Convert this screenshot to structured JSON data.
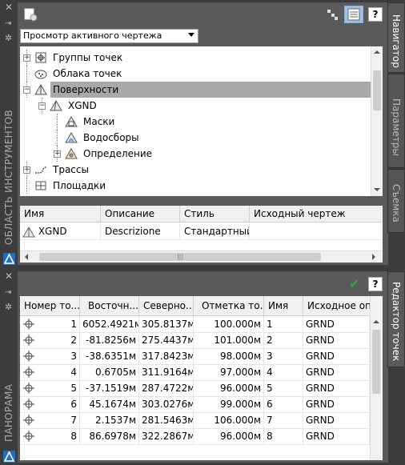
{
  "toolspace": {
    "side_title": "ОБЛАСТЬ ИНСТРУМЕНТОВ",
    "dropdown_value": "Просмотр активного чертежа",
    "tree": [
      {
        "label": "Группы точек",
        "icon": "point-groups-icon",
        "level": 1,
        "expander": "+"
      },
      {
        "label": "Облака точек",
        "icon": "point-clouds-icon",
        "level": 1,
        "expander": ""
      },
      {
        "label": "Поверхности",
        "icon": "surfaces-icon",
        "level": 1,
        "expander": "-",
        "selected": true
      },
      {
        "label": "XGND",
        "icon": "surface-icon",
        "level": 2,
        "expander": "-"
      },
      {
        "label": "Маски",
        "icon": "masks-icon",
        "level": 3,
        "expander": ""
      },
      {
        "label": "Водосборы",
        "icon": "watersheds-icon",
        "level": 3,
        "expander": ""
      },
      {
        "label": "Определение",
        "icon": "definition-icon",
        "level": 3,
        "expander": "+"
      },
      {
        "label": "Трассы",
        "icon": "alignments-icon",
        "level": 1,
        "expander": "+"
      },
      {
        "label": "Площадки",
        "icon": "sites-icon",
        "level": 1,
        "expander": ""
      }
    ],
    "list_headers": [
      "Имя",
      "Описание",
      "Стиль",
      "Исходный чертеж"
    ],
    "list_rows": [
      {
        "name": "XGND",
        "description": "Descrizione",
        "style": "Стандартный",
        "source": ""
      }
    ],
    "tabs": [
      "Навигатор",
      "Параметры",
      "Съемка"
    ]
  },
  "panorama": {
    "side_title": "ПАНОРАМА",
    "tab": "Редактор точек",
    "headers": [
      "Номер то...",
      "Восточн...",
      "Северно...",
      "Отметка то...",
      "Имя",
      "Исходное опи"
    ],
    "rows": [
      {
        "num": "1",
        "east": "6052.4921м",
        "north": "305.8137м",
        "elev": "100.000м",
        "name": "1",
        "desc": "GRND"
      },
      {
        "num": "2",
        "east": "-81.8256м",
        "north": "275.4437м",
        "elev": "101.000м",
        "name": "2",
        "desc": "GRND"
      },
      {
        "num": "3",
        "east": "-38.6351м",
        "north": "317.8423м",
        "elev": "98.000м",
        "name": "3",
        "desc": "GRND"
      },
      {
        "num": "4",
        "east": "0.6705м",
        "north": "311.9164м",
        "elev": "97.000м",
        "name": "4",
        "desc": "GRND"
      },
      {
        "num": "5",
        "east": "-37.1519м",
        "north": "287.4722м",
        "elev": "96.000м",
        "name": "5",
        "desc": "GRND"
      },
      {
        "num": "6",
        "east": "45.1674м",
        "north": "303.0276м",
        "elev": "99.000м",
        "name": "6",
        "desc": "GRND"
      },
      {
        "num": "7",
        "east": "2.1537м",
        "north": "281.5463м",
        "elev": "106.000м",
        "name": "7",
        "desc": "GRND"
      },
      {
        "num": "8",
        "east": "86.6978м",
        "north": "322.2867м",
        "elev": "96.000м",
        "name": "8",
        "desc": "GRND"
      }
    ]
  },
  "colors": {
    "selected_row": "#a9a9a9",
    "accent_check": "#3aa33a",
    "logo_blue": "#1f6fbf"
  }
}
